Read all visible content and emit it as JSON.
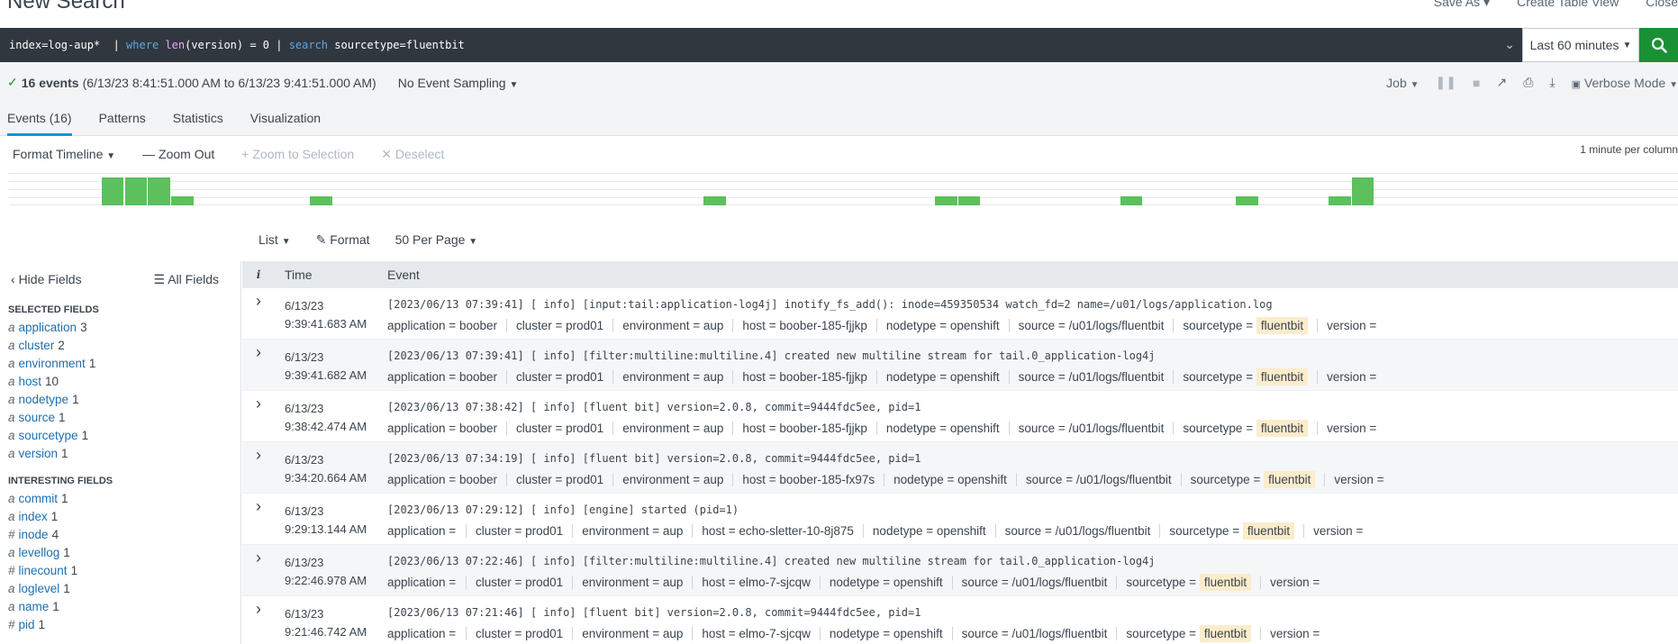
{
  "header": {
    "title": "New Search",
    "actions": [
      "Save As",
      "Create Table View",
      "Close"
    ]
  },
  "search": {
    "query_parts": {
      "p1": "index=log-aup*  | ",
      "kw1": "where",
      "p2": " ",
      "fn1": "len",
      "p3": "(version) = 0 | ",
      "kw2": "search",
      "p4": " sourcetype=fluentbit"
    },
    "time_range": "Last 60 minutes"
  },
  "status": {
    "events": "16 events",
    "range": "(6/13/23 8:41:51.000 AM to 6/13/23 9:41:51.000 AM)",
    "sampling": "No Event Sampling",
    "job": "Job",
    "mode": "Verbose Mode"
  },
  "tabs": [
    "Events (16)",
    "Patterns",
    "Statistics",
    "Visualization"
  ],
  "timeline": {
    "format": "Format Timeline",
    "zoom_out": "Zoom Out",
    "zoom_selection": "+ Zoom to Selection",
    "deselect": "Deselect",
    "scale": "1 minute per column",
    "bars": [
      {
        "col": 4,
        "count": 3
      },
      {
        "col": 5,
        "count": 3
      },
      {
        "col": 6,
        "count": 3
      },
      {
        "col": 7,
        "count": 1
      },
      {
        "col": 13,
        "count": 1
      },
      {
        "col": 30,
        "count": 1
      },
      {
        "col": 40,
        "count": 1
      },
      {
        "col": 41,
        "count": 1
      },
      {
        "col": 48,
        "count": 1
      },
      {
        "col": 53,
        "count": 1
      },
      {
        "col": 57,
        "count": 1
      },
      {
        "col": 58,
        "count": 3
      }
    ],
    "max_count": 3
  },
  "list_controls": {
    "list": "List",
    "format": "Format",
    "per_page": "50 Per Page"
  },
  "sidebar": {
    "hide_fields": "Hide Fields",
    "all_fields": "All Fields",
    "selected_title": "SELECTED FIELDS",
    "selected": [
      {
        "type": "a",
        "name": "application",
        "count": "3"
      },
      {
        "type": "a",
        "name": "cluster",
        "count": "2"
      },
      {
        "type": "a",
        "name": "environment",
        "count": "1"
      },
      {
        "type": "a",
        "name": "host",
        "count": "10"
      },
      {
        "type": "a",
        "name": "nodetype",
        "count": "1"
      },
      {
        "type": "a",
        "name": "source",
        "count": "1"
      },
      {
        "type": "a",
        "name": "sourcetype",
        "count": "1"
      },
      {
        "type": "a",
        "name": "version",
        "count": "1"
      }
    ],
    "interesting_title": "INTERESTING FIELDS",
    "interesting": [
      {
        "type": "a",
        "name": "commit",
        "count": "1"
      },
      {
        "type": "a",
        "name": "index",
        "count": "1"
      },
      {
        "type": "#",
        "name": "inode",
        "count": "4"
      },
      {
        "type": "a",
        "name": "levellog",
        "count": "1"
      },
      {
        "type": "#",
        "name": "linecount",
        "count": "1"
      },
      {
        "type": "a",
        "name": "loglevel",
        "count": "1"
      },
      {
        "type": "a",
        "name": "name",
        "count": "1"
      },
      {
        "type": "#",
        "name": "pid",
        "count": "1"
      }
    ]
  },
  "table": {
    "col_i": "i",
    "col_time": "Time",
    "col_event": "Event",
    "rows": [
      {
        "date": "6/13/23",
        "time": "9:39:41.683 AM",
        "raw": "[2023/06/13 07:39:41] [ info] [input:tail:application-log4j] inotify_fs_add(): inode=459350534 watch_fd=2 name=/u01/logs/application.log",
        "fields": [
          [
            "application",
            "boober"
          ],
          [
            "cluster",
            "prod01"
          ],
          [
            "environment",
            "aup"
          ],
          [
            "host",
            "boober-185-fjjkp"
          ],
          [
            "nodetype",
            "openshift"
          ],
          [
            "source",
            "/u01/logs/fluentbit"
          ],
          [
            "sourcetype",
            "fluentbit"
          ],
          [
            "version",
            ""
          ]
        ]
      },
      {
        "date": "6/13/23",
        "time": "9:39:41.682 AM",
        "raw": "[2023/06/13 07:39:41] [ info] [filter:multiline:multiline.4] created new multiline stream for tail.0_application-log4j",
        "fields": [
          [
            "application",
            "boober"
          ],
          [
            "cluster",
            "prod01"
          ],
          [
            "environment",
            "aup"
          ],
          [
            "host",
            "boober-185-fjjkp"
          ],
          [
            "nodetype",
            "openshift"
          ],
          [
            "source",
            "/u01/logs/fluentbit"
          ],
          [
            "sourcetype",
            "fluentbit"
          ],
          [
            "version",
            ""
          ]
        ]
      },
      {
        "date": "6/13/23",
        "time": "9:38:42.474 AM",
        "raw": "[2023/06/13 07:38:42] [ info] [fluent bit] version=2.0.8, commit=9444fdc5ee, pid=1",
        "fields": [
          [
            "application",
            "boober"
          ],
          [
            "cluster",
            "prod01"
          ],
          [
            "environment",
            "aup"
          ],
          [
            "host",
            "boober-185-fjjkp"
          ],
          [
            "nodetype",
            "openshift"
          ],
          [
            "source",
            "/u01/logs/fluentbit"
          ],
          [
            "sourcetype",
            "fluentbit"
          ],
          [
            "version",
            ""
          ]
        ]
      },
      {
        "date": "6/13/23",
        "time": "9:34:20.664 AM",
        "raw": "[2023/06/13 07:34:19] [ info] [fluent bit] version=2.0.8, commit=9444fdc5ee, pid=1",
        "fields": [
          [
            "application",
            "boober"
          ],
          [
            "cluster",
            "prod01"
          ],
          [
            "environment",
            "aup"
          ],
          [
            "host",
            "boober-185-fx97s"
          ],
          [
            "nodetype",
            "openshift"
          ],
          [
            "source",
            "/u01/logs/fluentbit"
          ],
          [
            "sourcetype",
            "fluentbit"
          ],
          [
            "version",
            ""
          ]
        ]
      },
      {
        "date": "6/13/23",
        "time": "9:29:13.144 AM",
        "raw": "[2023/06/13 07:29:12] [ info] [engine] started (pid=1)",
        "fields": [
          [
            "application",
            ""
          ],
          [
            "cluster",
            "prod01"
          ],
          [
            "environment",
            "aup"
          ],
          [
            "host",
            "echo-sletter-10-8j875"
          ],
          [
            "nodetype",
            "openshift"
          ],
          [
            "source",
            "/u01/logs/fluentbit"
          ],
          [
            "sourcetype",
            "fluentbit"
          ],
          [
            "version",
            ""
          ]
        ]
      },
      {
        "date": "6/13/23",
        "time": "9:22:46.978 AM",
        "raw": "[2023/06/13 07:22:46] [ info] [filter:multiline:multiline.4] created new multiline stream for tail.0_application-log4j",
        "fields": [
          [
            "application",
            ""
          ],
          [
            "cluster",
            "prod01"
          ],
          [
            "environment",
            "aup"
          ],
          [
            "host",
            "elmo-7-sjcqw"
          ],
          [
            "nodetype",
            "openshift"
          ],
          [
            "source",
            "/u01/logs/fluentbit"
          ],
          [
            "sourcetype",
            "fluentbit"
          ],
          [
            "version",
            ""
          ]
        ]
      },
      {
        "date": "6/13/23",
        "time": "9:21:46.742 AM",
        "raw": "[2023/06/13 07:21:46] [ info] [fluent bit] version=2.0.8, commit=9444fdc5ee, pid=1",
        "fields": [
          [
            "application",
            ""
          ],
          [
            "cluster",
            "prod01"
          ],
          [
            "environment",
            "aup"
          ],
          [
            "host",
            "elmo-7-sjcqw"
          ],
          [
            "nodetype",
            "openshift"
          ],
          [
            "source",
            "/u01/logs/fluentbit"
          ],
          [
            "sourcetype",
            "fluentbit"
          ],
          [
            "version",
            ""
          ]
        ]
      }
    ]
  },
  "colors": {
    "accent": "#1d8fd6",
    "search_bg": "#31373e",
    "go_button": "#1a9035",
    "timeline_bar": "#5cc05c",
    "highlight": "#fbeccc"
  }
}
